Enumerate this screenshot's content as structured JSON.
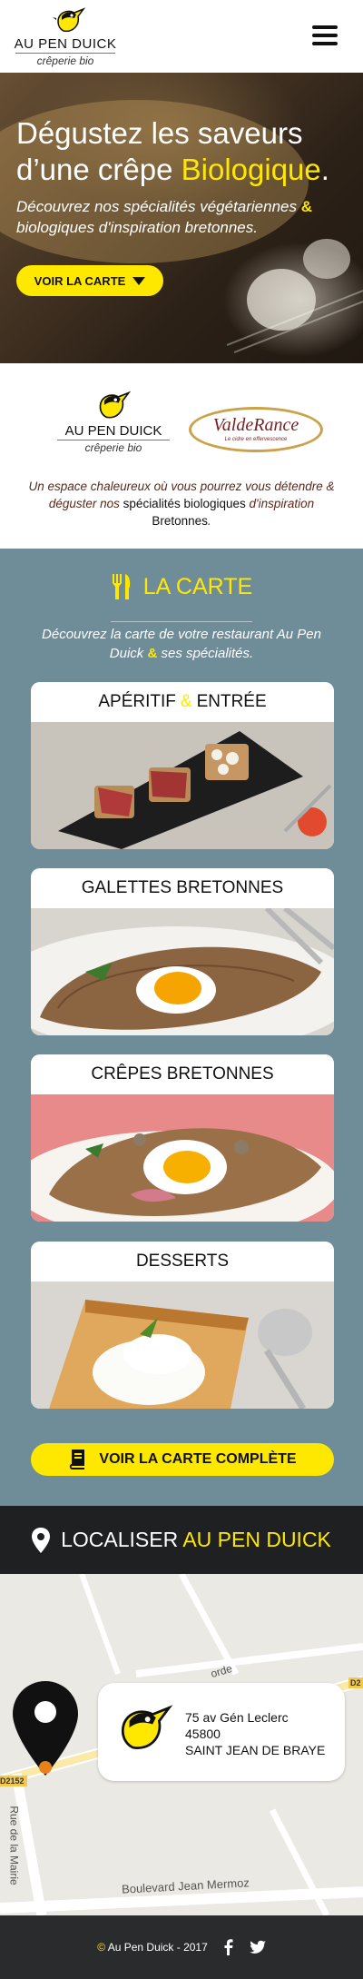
{
  "header": {
    "logo_name": "AU PEN DUICK",
    "logo_sub": "crêperie bio"
  },
  "hero": {
    "title_part1": "Dégustez les saveurs d’une crêpe ",
    "title_highlight": "Biologique",
    "title_end": ".",
    "sub_part1": "Découvrez nos spécialités végétariennes ",
    "sub_amp": "&",
    "sub_part2": " biologiques d'inspiration bretonnes.",
    "button": "VOIR LA CARTE"
  },
  "partners": {
    "logo_name": "AU PEN DUICK",
    "logo_sub": "crêperie bio",
    "partner_name": "ValdeRance",
    "partner_tagline": "Le cidre en effervescence",
    "text_part1": "Un espace chaleureux où vous pourrez vous détendre & déguster nos ",
    "text_bold1": "spécialités biologiques",
    "text_part2": " d'inspiration ",
    "text_bold2": "Bretonnes",
    "text_end": "."
  },
  "carte": {
    "title": "LA CARTE",
    "desc_part1": "Découvrez la carte de votre restaurant Au Pen Duick ",
    "desc_amp": "&",
    "desc_part2": " ses spécialités.",
    "cards": [
      {
        "title_a": "APÉRITIF",
        "title_amp": "&",
        "title_b": "ENTRÉE"
      },
      {
        "title": "GALETTES BRETONNES"
      },
      {
        "title": "CRÊPES BRETONNES"
      },
      {
        "title": "DESSERTS"
      }
    ],
    "full_button": "VOIR LA CARTE COMPLÈTE"
  },
  "locate": {
    "prefix": "LOCALISER ",
    "highlight": "AU PEN DUICK"
  },
  "map": {
    "road_1": "Rue de la Mairie",
    "road_2": "Boulevard Jean Mermoz",
    "road_3": "orde",
    "badge_1": "D2152",
    "badge_2": "D2",
    "address_line1": "75 av Gén Leclerc",
    "address_line2": "45800",
    "address_line3": "SAINT JEAN DE BRAYE"
  },
  "footer": {
    "copyright_symbol": "©",
    "text": " Au Pen Duick - 2017"
  },
  "colors": {
    "accent": "#ffe800",
    "carte_bg": "#6f8c99",
    "dark_band": "#1f2022"
  }
}
